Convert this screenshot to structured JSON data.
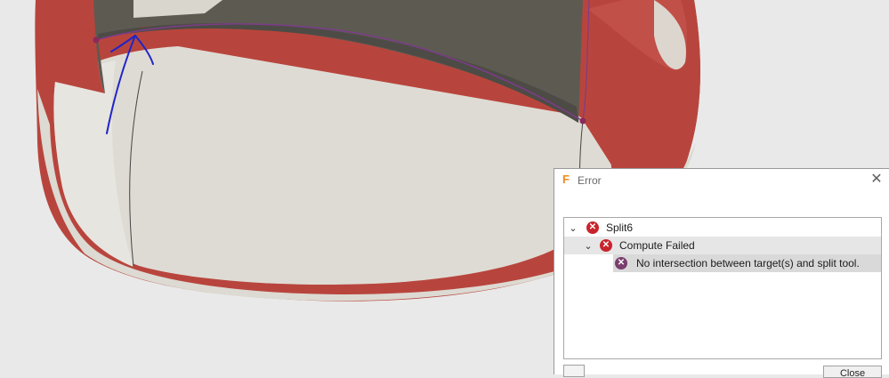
{
  "viewport": {
    "colors": {
      "background": "#e9e9e9",
      "shell_red": "#b8453d",
      "inner_dark": "#5d5a52",
      "rim_light": "#dcdad2",
      "floor": "#dedbd4",
      "sketch_purple": "#7c3c8a",
      "annotation_blue": "#1f25c9"
    }
  },
  "dialog": {
    "title": "Error",
    "app_icon": "F",
    "close_glyph": "✕",
    "close_button_label": "Close",
    "tree": [
      {
        "label": "Split6",
        "icon": "error-icon"
      },
      {
        "label": "Compute Failed",
        "icon": "error-icon"
      },
      {
        "label": "No intersection between target(s) and split tool.",
        "icon": "error-detail-icon"
      }
    ]
  }
}
